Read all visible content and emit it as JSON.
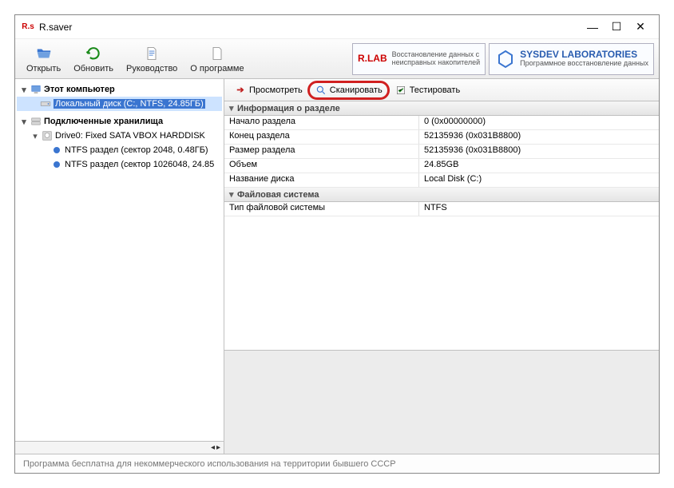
{
  "window": {
    "icon_text": "R.s",
    "title": "R.saver"
  },
  "toolbar": {
    "open": "Открыть",
    "refresh": "Обновить",
    "manual": "Руководство",
    "about": "О программе"
  },
  "brands": {
    "rlab": {
      "logo": "R.LAB",
      "line1": "Восстановление данных с",
      "line2": "неисправных накопителей"
    },
    "sysdev": {
      "line1": "SYSDEV LABORATORIES",
      "line2": "Программное восстановление данных"
    }
  },
  "tree": {
    "computer": "Этот компьютер",
    "local_disk": "Локальный диск (C:, NTFS, 24.85ГБ)",
    "storages": "Подключенные хранилища",
    "drive0": "Drive0: Fixed SATA VBOX HARDDISK",
    "part1": "NTFS раздел (сектор 2048, 0.48ГБ)",
    "part2": "NTFS раздел (сектор 1026048, 24.85"
  },
  "actions": {
    "view": "Просмотреть",
    "scan": "Сканировать",
    "test": "Тестировать"
  },
  "info": {
    "section_partition": "Информация о разделе",
    "rows_partition": [
      {
        "k": "Начало раздела",
        "v": "0 (0x00000000)"
      },
      {
        "k": "Конец раздела",
        "v": "52135936 (0x031B8800)"
      },
      {
        "k": "Размер раздела",
        "v": "52135936 (0x031B8800)"
      },
      {
        "k": "Объем",
        "v": "24.85GB"
      },
      {
        "k": "Название диска",
        "v": "Local Disk (C:)"
      }
    ],
    "section_fs": "Файловая система",
    "rows_fs": [
      {
        "k": "Тип файловой системы",
        "v": "NTFS"
      }
    ]
  },
  "status": "Программа бесплатна для некоммерческого использования на территории бывшего СССР"
}
